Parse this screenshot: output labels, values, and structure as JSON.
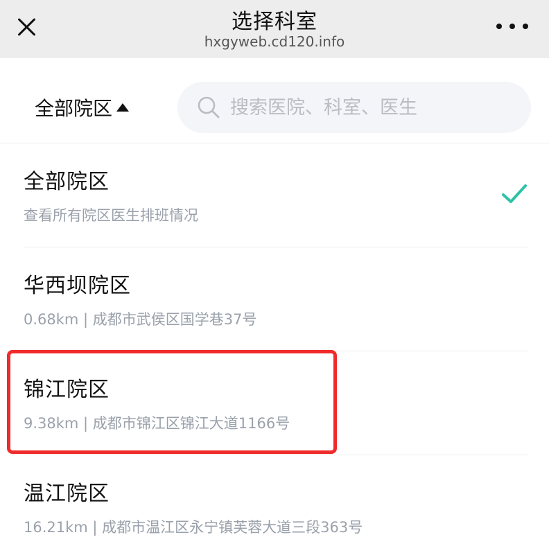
{
  "header": {
    "title": "选择科室",
    "domain": "hxgyweb.cd120.info"
  },
  "filter": {
    "campus_label": "全部院区",
    "search_placeholder": "搜索医院、科室、医生"
  },
  "campuses": [
    {
      "name": "全部院区",
      "subtitle": "查看所有院区医生排班情况",
      "selected": true
    },
    {
      "name": "华西坝院区",
      "subtitle": "0.68km | 成都市武侯区国学巷37号",
      "selected": false
    },
    {
      "name": "锦江院区",
      "subtitle": "9.38km | 成都市锦江区锦江大道1166号",
      "selected": false
    },
    {
      "name": "温江院区",
      "subtitle": "16.21km | 成都市温江区永宁镇芙蓉大道三段363号",
      "selected": false
    }
  ],
  "colors": {
    "check": "#2bc3a6",
    "highlight": "#ef2b2b"
  }
}
